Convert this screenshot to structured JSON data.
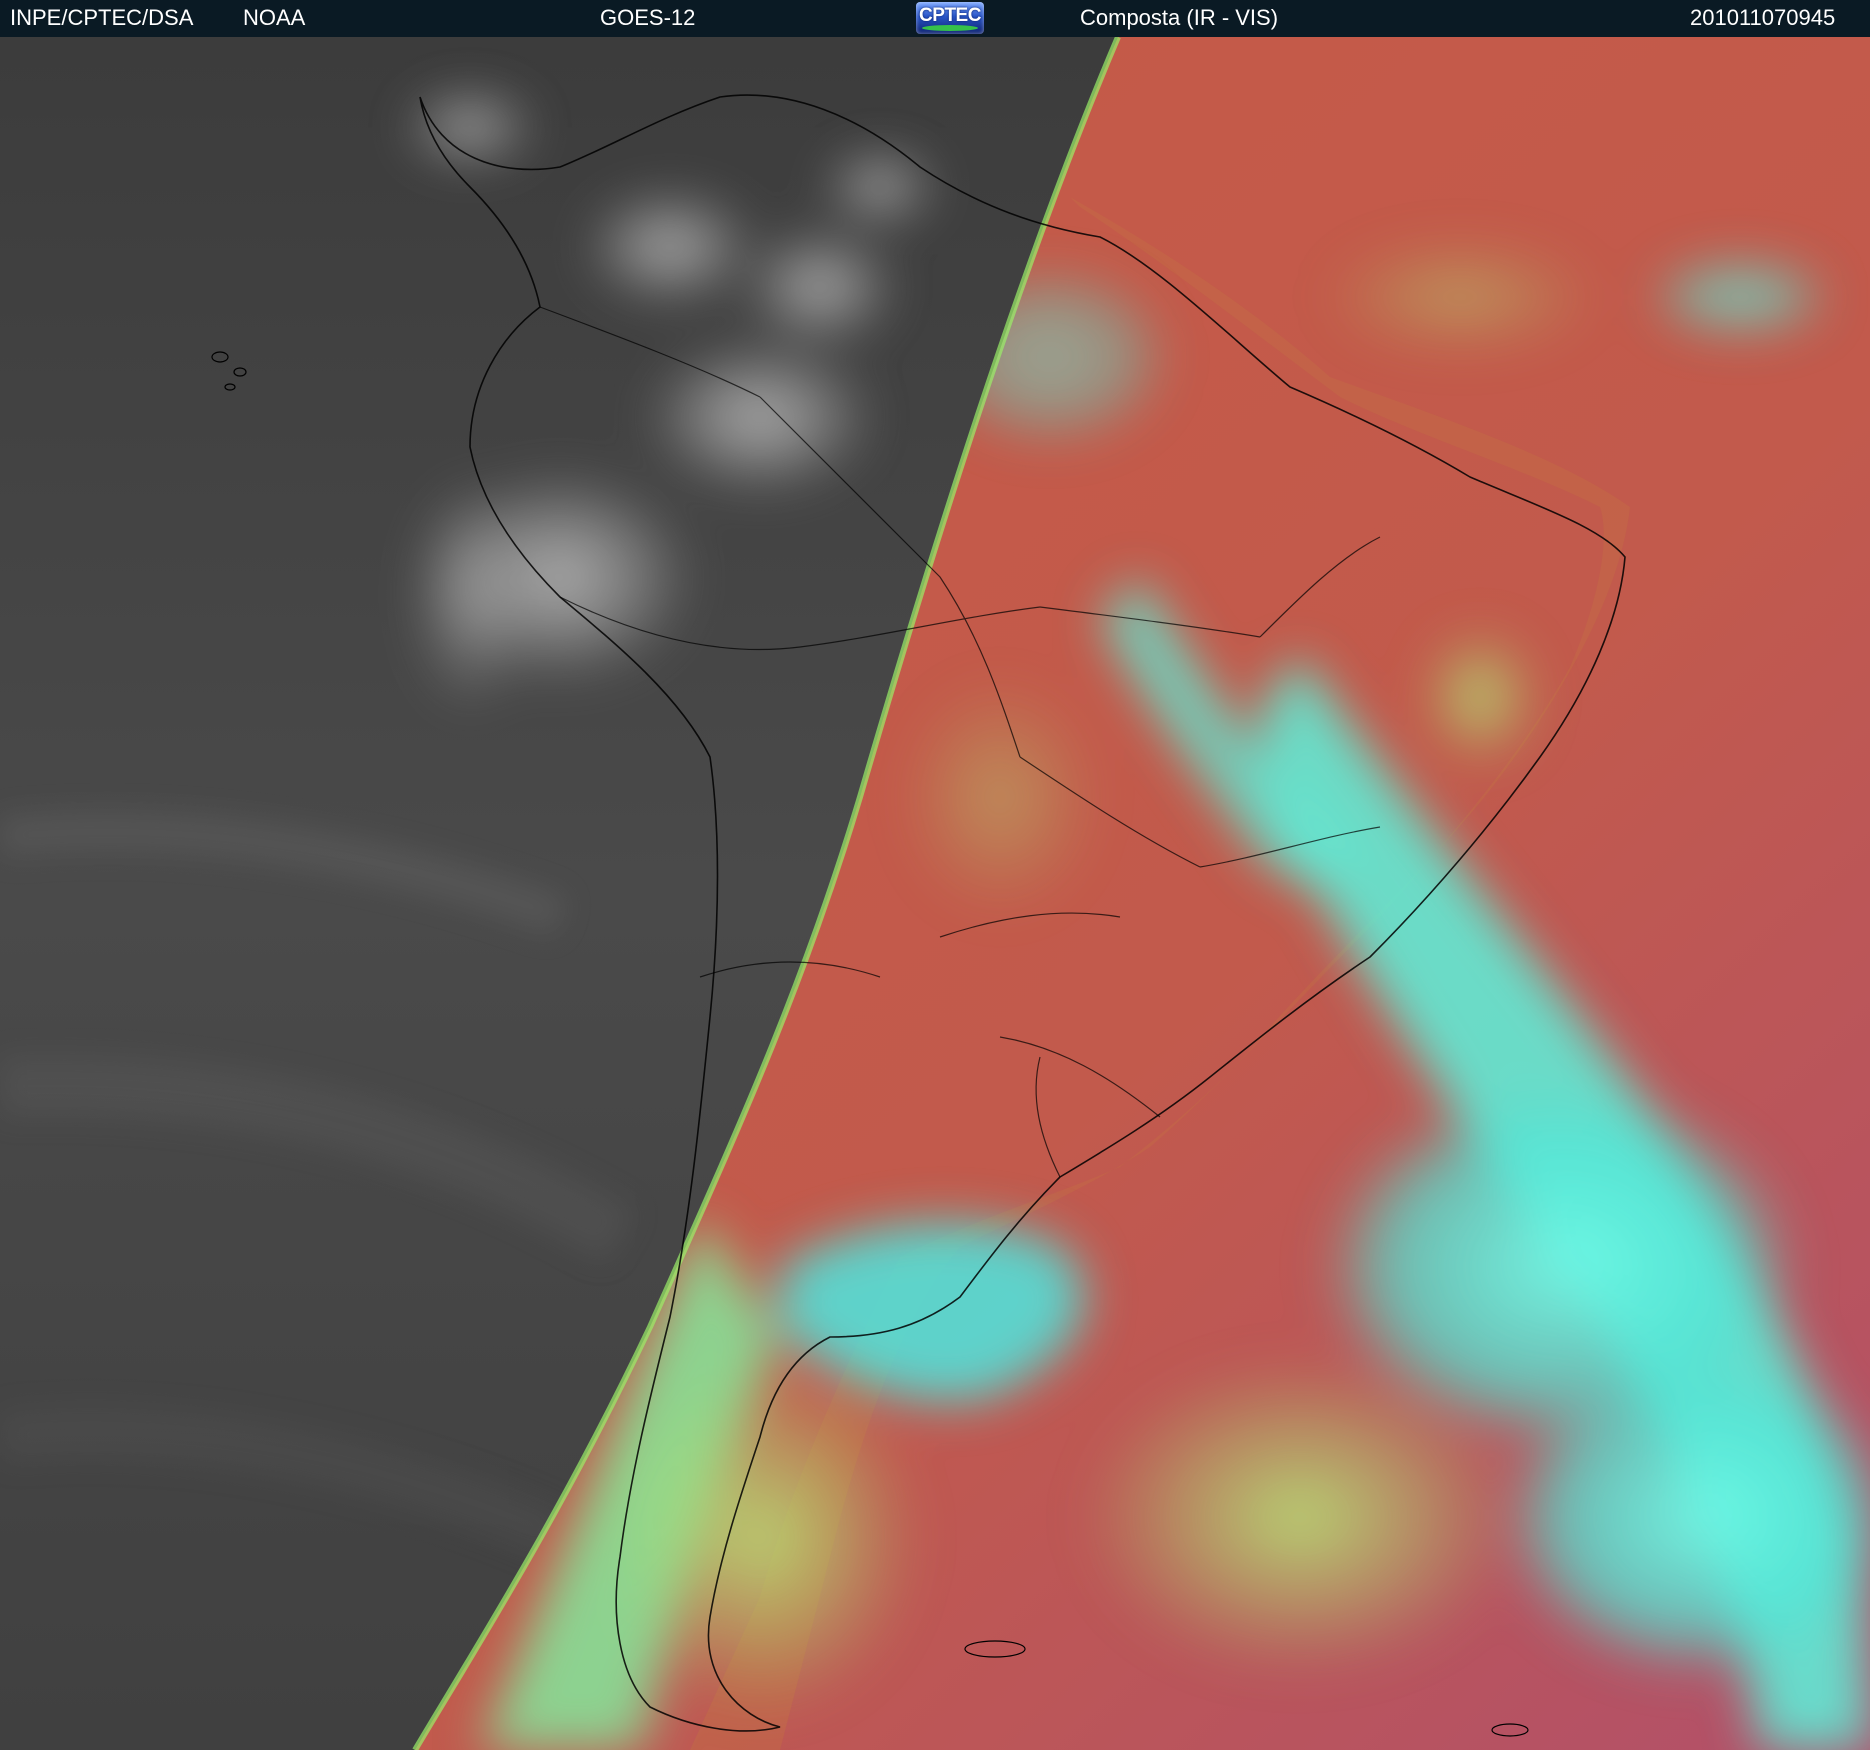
{
  "header": {
    "source_label": "INPE/CPTEC/DSA",
    "agency_label": "NOAA",
    "satellite_label": "GOES-12",
    "logo_text": "CPTEC",
    "product_label": "Composta (IR - VIS)",
    "timestamp_label": "201011070945"
  },
  "imagery": {
    "night_side_color": "#3a3a3a",
    "day_side_ocean_color": "#c25548",
    "cloud_cyan_color": "#4ff0d8",
    "cloud_green_color": "#a8e070",
    "land_color": "#c86a48",
    "coastline_color": "#000000",
    "terminator_color": "#9af068"
  }
}
